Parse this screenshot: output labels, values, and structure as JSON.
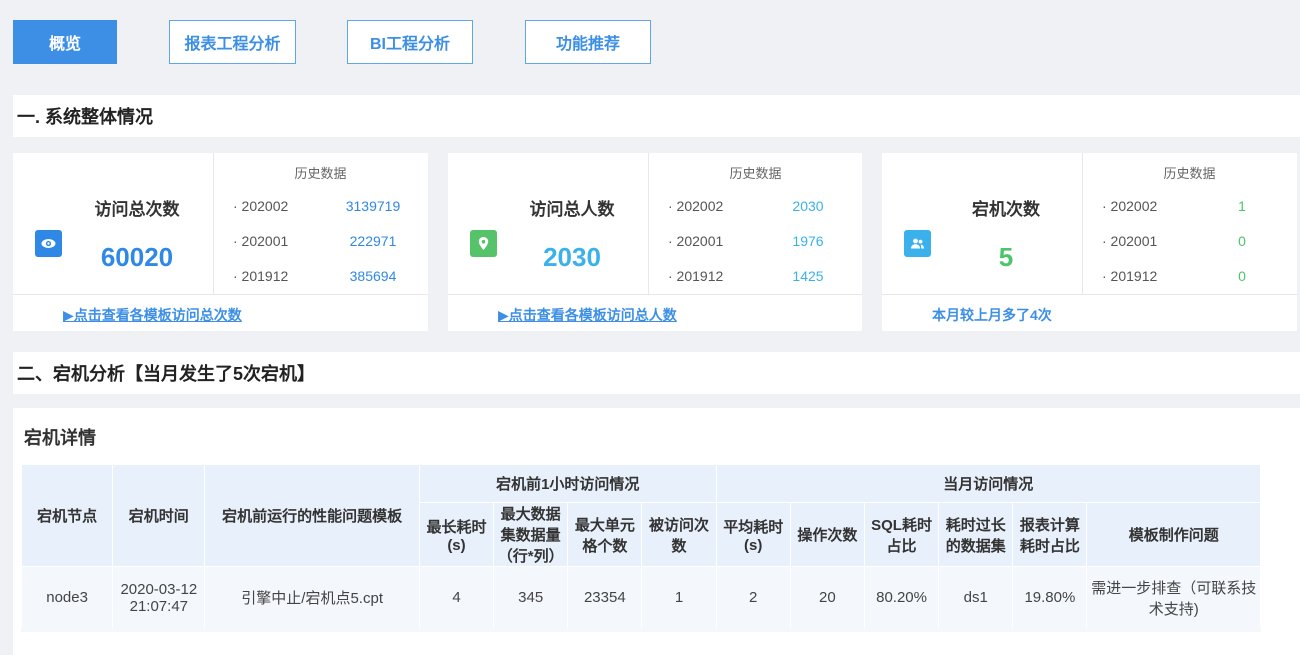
{
  "tabs": [
    {
      "label": "概览",
      "active": true
    },
    {
      "label": "报表工程分析",
      "active": false
    },
    {
      "label": "BI工程分析",
      "active": false
    },
    {
      "label": "功能推荐",
      "active": false
    }
  ],
  "section1": {
    "title": "一. 系统整体情况"
  },
  "cards": [
    {
      "icon": "eye-icon",
      "icon_color": "#2f88e6",
      "label": "访问总次数",
      "value": "60020",
      "value_color": "#2f88e6",
      "history_title": "历史数据",
      "history": [
        {
          "period": "· 202002",
          "value": "3139719"
        },
        {
          "period": "· 202001",
          "value": "222971"
        },
        {
          "period": "· 201912",
          "value": "385694"
        }
      ],
      "history_color": "#2f88e6",
      "footer": "▶点击查看各模板访问总次数"
    },
    {
      "icon": "location-pin-icon",
      "icon_color": "#56c26a",
      "label": "访问总人数",
      "value": "2030",
      "value_color": "#3bb1ec",
      "history_title": "历史数据",
      "history": [
        {
          "period": "· 202002",
          "value": "2030"
        },
        {
          "period": "· 202001",
          "value": "1976"
        },
        {
          "period": "· 201912",
          "value": "1425"
        }
      ],
      "history_color": "#3bb1ec",
      "footer": "▶点击查看各模板访问总人数"
    },
    {
      "icon": "users-icon",
      "icon_color": "#3bb1ec",
      "label": "宕机次数",
      "value": "5",
      "value_color": "#4cc46a",
      "history_title": "历史数据",
      "history": [
        {
          "period": "· 202002",
          "value": "1"
        },
        {
          "period": "· 202001",
          "value": "0"
        },
        {
          "period": "· 201912",
          "value": "0"
        }
      ],
      "history_color": "#4cc46a",
      "footer": "本月较上月多了4次"
    }
  ],
  "section2": {
    "title": "二、宕机分析【当月发生了5次宕机】"
  },
  "detail": {
    "title": "宕机详情",
    "group_headers": {
      "before": "宕机前1小时访问情况",
      "month": "当月访问情况"
    },
    "columns": {
      "node": "宕机节点",
      "time": "宕机时间",
      "template": "宕机前运行的性能问题模板",
      "max_duration": "最长耗时(s)",
      "max_dataset": "最大数据集数据量（行*列）",
      "max_cells": "最大单元格个数",
      "visits": "被访问次数",
      "avg_duration": "平均耗时(s)",
      "ops": "操作次数",
      "sql_ratio": "SQL耗时占比",
      "slow_dataset": "耗时过长的数据集",
      "calc_ratio": "报表计算耗时占比",
      "problem": "模板制作问题"
    },
    "rows": [
      {
        "node": "node3",
        "time": "2020-03-12 21:07:47",
        "template": "引擎中止/宕机点5.cpt",
        "max_duration": "4",
        "max_dataset": "345",
        "max_cells": "23354",
        "visits": "1",
        "avg_duration": "2",
        "ops": "20",
        "sql_ratio": "80.20%",
        "slow_dataset": "ds1",
        "calc_ratio": "19.80%",
        "problem": "需进一步排查（可联系技术支持)"
      }
    ]
  }
}
